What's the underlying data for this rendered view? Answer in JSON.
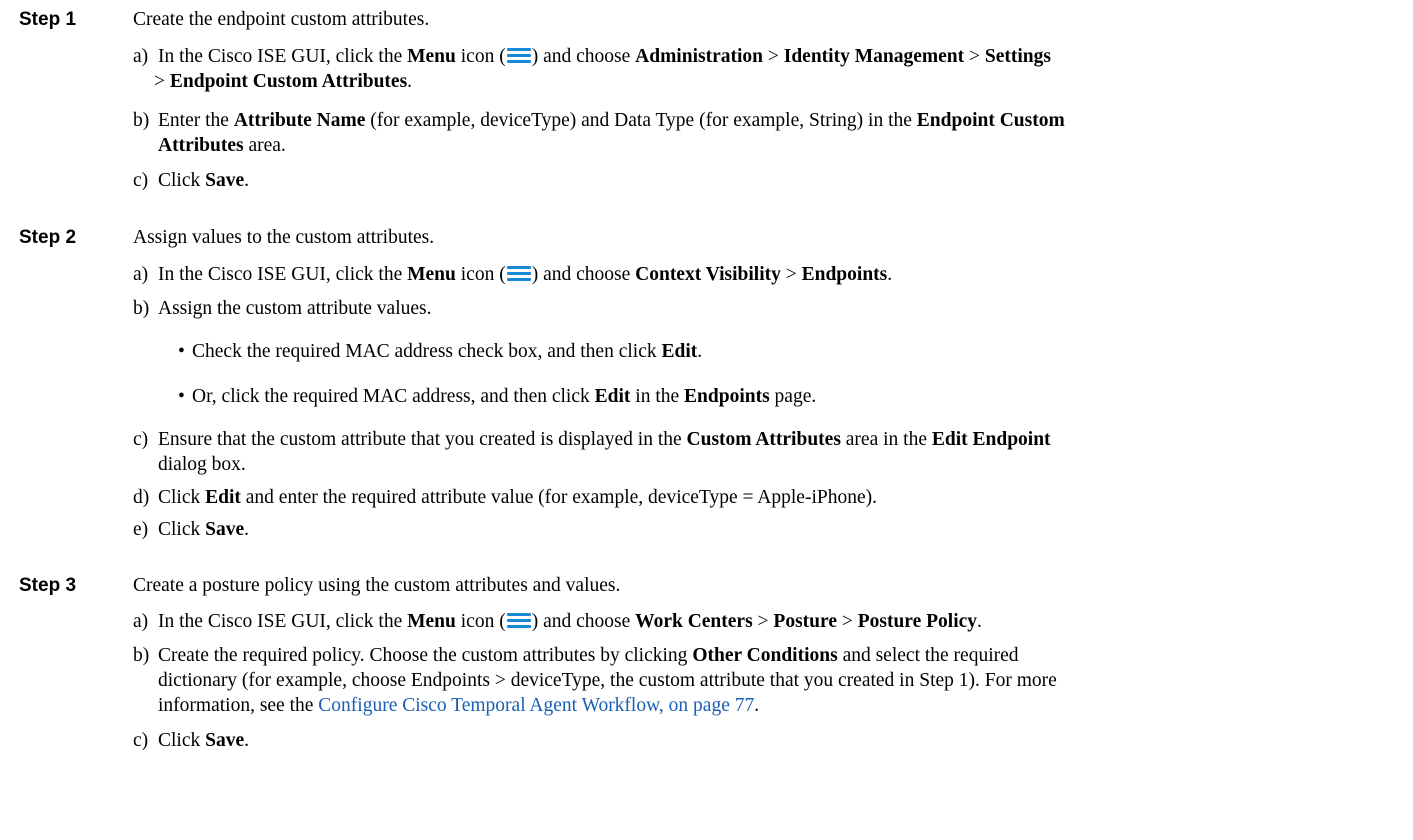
{
  "menu_icon": {
    "name": "menu-icon",
    "color": "#1a88d6"
  },
  "link_color": "#1a5fb4",
  "steps": [
    {
      "label": "Step 1",
      "text": "Create the endpoint custom attributes.",
      "substeps": [
        {
          "marker": "a)",
          "parts": [
            "In the Cisco ISE GUI, click the ",
            "Menu",
            " icon (",
            ") and choose ",
            "Administration",
            " > ",
            "Identity Management",
            " > ",
            "Settings",
            "> ",
            "Endpoint Custom Attributes",
            "."
          ]
        },
        {
          "marker": "b)",
          "parts": [
            "Enter the ",
            "Attribute Name",
            " (for example, deviceType) and Data Type (for example, String) in the ",
            "Endpoint Custom",
            "Attributes",
            " area."
          ]
        },
        {
          "marker": "c)",
          "parts": [
            "Click ",
            "Save",
            "."
          ]
        }
      ]
    },
    {
      "label": "Step 2",
      "text": "Assign values to the custom attributes.",
      "substeps": [
        {
          "marker": "a)",
          "parts": [
            "In the Cisco ISE GUI, click the ",
            "Menu",
            " icon (",
            ") and choose ",
            "Context Visibility",
            " > ",
            "Endpoints",
            "."
          ]
        },
        {
          "marker": "b)",
          "parts": [
            "Assign the custom attribute values."
          ]
        },
        {
          "marker": "c)",
          "parts": [
            "Ensure that the custom attribute that you created is displayed in the ",
            "Custom Attributes",
            " area in the ",
            "Edit Endpoint",
            "dialog box."
          ]
        },
        {
          "marker": "d)",
          "parts": [
            "Click ",
            "Edit",
            " and enter the required attribute value (for example, deviceType = Apple-iPhone)."
          ]
        },
        {
          "marker": "e)",
          "parts": [
            "Click ",
            "Save",
            "."
          ]
        }
      ],
      "bullets": [
        {
          "marker": "•",
          "parts": [
            "Check the required MAC address check box, and then click ",
            "Edit",
            "."
          ]
        },
        {
          "marker": "•",
          "parts": [
            "Or, click the required MAC address, and then click ",
            "Edit",
            " in the ",
            "Endpoints",
            " page."
          ]
        }
      ]
    },
    {
      "label": "Step 3",
      "text": "Create a posture policy using the custom attributes and values.",
      "substeps": [
        {
          "marker": "a)",
          "parts": [
            "In the Cisco ISE GUI, click the ",
            "Menu",
            " icon (",
            ") and choose ",
            "Work Centers",
            " > ",
            "Posture",
            " > ",
            "Posture Policy",
            "."
          ]
        },
        {
          "marker": "b)",
          "parts": [
            "Create the required policy. Choose the custom attributes by clicking ",
            "Other Conditions",
            " and select the required",
            "dictionary (for example, choose Endpoints > deviceType, the custom attribute that you created in Step 1). For more",
            "information, see the ",
            "Configure Cisco Temporal Agent Workflow, on page 77",
            "."
          ]
        },
        {
          "marker": "c)",
          "parts": [
            "Click ",
            "Save",
            "."
          ]
        }
      ]
    }
  ]
}
